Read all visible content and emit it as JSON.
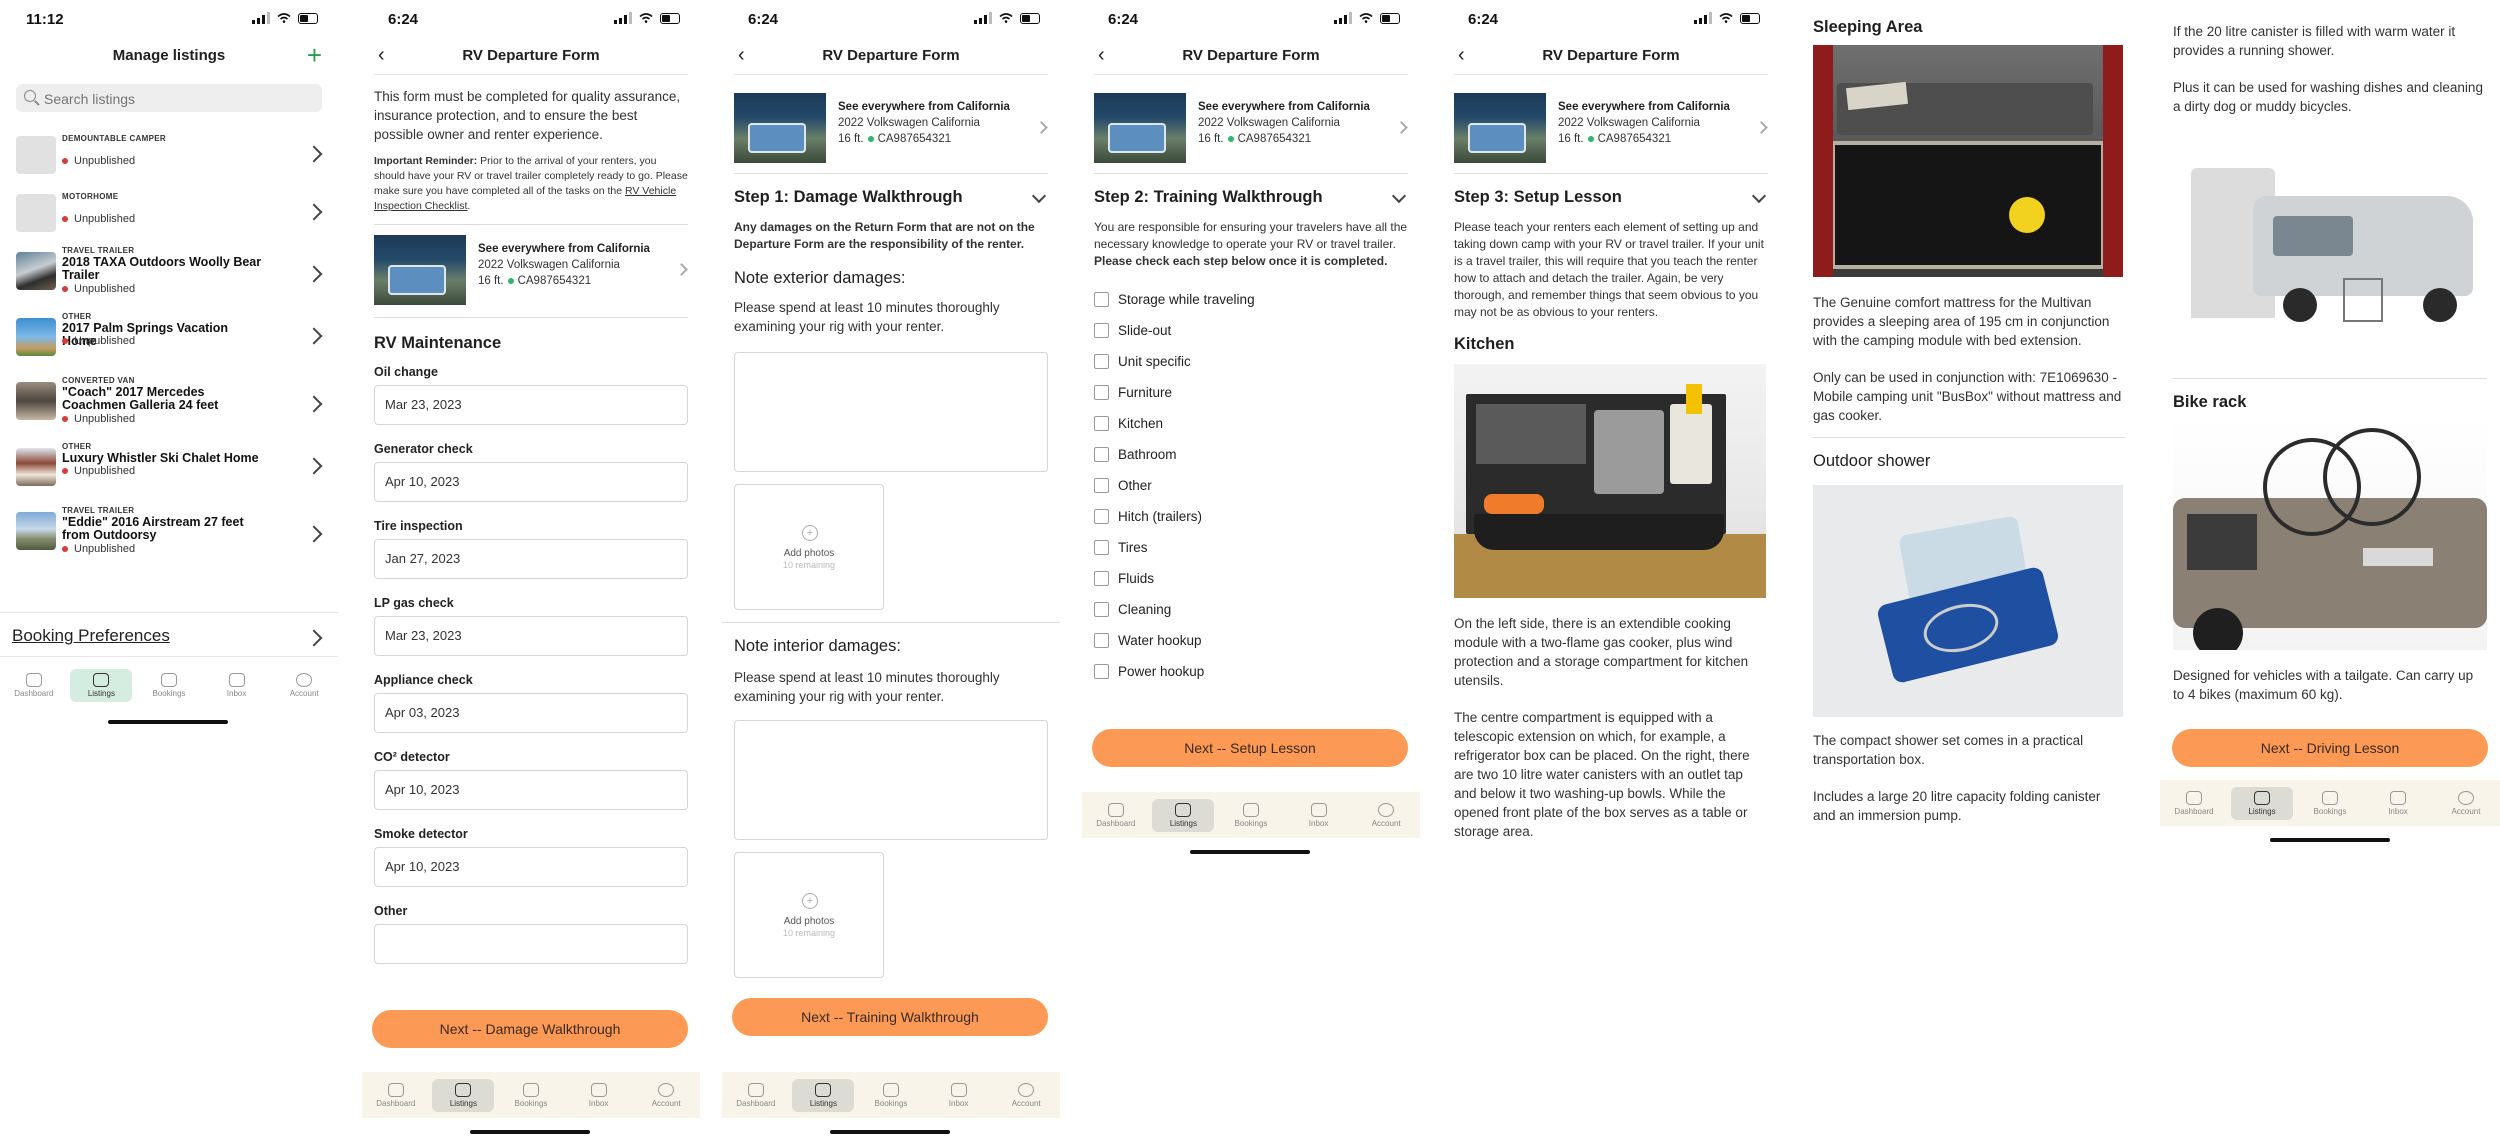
{
  "status_bars": [
    {
      "time": "11:12"
    },
    {
      "time": "6:24"
    },
    {
      "time": "6:24"
    },
    {
      "time": "6:24"
    },
    {
      "time": "6:24"
    }
  ],
  "tabs": [
    {
      "label": "Dashboard",
      "icon": "dashboard-icon"
    },
    {
      "label": "Listings",
      "icon": "listings-icon"
    },
    {
      "label": "Bookings",
      "icon": "bookings-icon"
    },
    {
      "label": "Inbox",
      "icon": "inbox-icon"
    },
    {
      "label": "Account",
      "icon": "account-icon"
    }
  ],
  "manage": {
    "title": "Manage listings",
    "search_placeholder": "Search listings",
    "items": [
      {
        "category": "DEMOUNTABLE CAMPER",
        "name": "",
        "status": "Unpublished"
      },
      {
        "category": "MOTORHOME",
        "name": "",
        "status": "Unpublished"
      },
      {
        "category": "TRAVEL TRAILER",
        "name": "2018 TAXA Outdoors Woolly Bear Trailer",
        "status": "Unpublished"
      },
      {
        "category": "OTHER",
        "name": "2017 Palm Springs Vacation Home",
        "status": "Unpublished"
      },
      {
        "category": "CONVERTED VAN",
        "name": "\"Coach\" 2017 Mercedes Coachmen Galleria 24 feet",
        "status": "Unpublished"
      },
      {
        "category": "OTHER",
        "name": "Luxury Whistler Ski Chalet Home",
        "status": "Unpublished"
      },
      {
        "category": "TRAVEL TRAILER",
        "name": "\"Eddie\" 2016 Airstream 27 feet from Outdoorsy",
        "status": "Unpublished"
      }
    ],
    "booking_prefs": "Booking Preferences"
  },
  "form": {
    "title": "RV Departure Form",
    "intro": "This form must be completed for quality assurance, insurance protection, and to ensure the best possible owner and renter experience.",
    "reminder_label": "Important Reminder:",
    "reminder_text": " Prior to the arrival of your renters, you should have your RV or travel trailer completely ready to go. Please make sure you have completed all of the tasks on the ",
    "reminder_link": "RV Vehicle Inspection Checklist",
    "reminder_end": "."
  },
  "vehicle": {
    "title": "See everywhere from California",
    "model": "2022 Volkswagen California",
    "length": "16 ft.",
    "plate": "CA987654321"
  },
  "maintenance": {
    "heading": "RV Maintenance",
    "fields": [
      {
        "label": "Oil change",
        "value": "Mar 23, 2023"
      },
      {
        "label": "Generator check",
        "value": "Apr 10, 2023"
      },
      {
        "label": "Tire inspection",
        "value": "Jan 27, 2023"
      },
      {
        "label": "LP gas check",
        "value": "Mar 23, 2023"
      },
      {
        "label": "Appliance check",
        "value": "Apr 03, 2023"
      },
      {
        "label": "CO² detector",
        "value": "Apr 10, 2023"
      },
      {
        "label": "Smoke detector",
        "value": "Apr 10, 2023"
      },
      {
        "label": "Other",
        "value": ""
      }
    ],
    "next": "Next -- Damage Walkthrough"
  },
  "damage": {
    "heading": "Step 1: Damage Walkthrough",
    "note": "Any damages on the Return Form that are not on the Departure Form are the responsibility of the renter.",
    "ext_heading": "Note exterior damages:",
    "ext_text": "Please spend at least 10 minutes thoroughly examining your rig with your renter.",
    "int_heading": "Note interior damages:",
    "int_text": "Please spend at least 10 minutes thoroughly examining your rig with your renter.",
    "add_photos": "Add photos",
    "remaining": "10 remaining",
    "next": "Next -- Training Walkthrough"
  },
  "training": {
    "heading": "Step 2: Training Walkthrough",
    "intro": "You are responsible for ensuring your travelers have all the necessary knowledge to operate your RV or travel trailer.",
    "intro_bold": "Please check each step below once it is completed.",
    "items": [
      "Storage while traveling",
      "Slide-out",
      "Unit specific",
      "Furniture",
      "Kitchen",
      "Bathroom",
      "Other",
      "Hitch (trailers)",
      "Tires",
      "Fluids",
      "Cleaning",
      "Water hookup",
      "Power hookup"
    ],
    "next": "Next -- Setup Lesson"
  },
  "setup": {
    "heading": "Step 3: Setup Lesson",
    "intro": "Please teach your renters each element of setting up and taking down camp with your RV or travel trailer. If your unit is a travel trailer, this will require that you teach the renter how to attach and detach the trailer. Again, be very thorough, and remember things that seem obvious to you may not be as obvious to your renters.",
    "kitchen_heading": "Kitchen",
    "kitchen_p1": "On the left side, there is an extendible cooking module with a two-flame gas cooker, plus wind protection and a storage compartment for kitchen utensils.",
    "kitchen_p2": "The centre compartment is equipped with a telescopic extension on which, for example, a refrigerator box can be placed. On the right, there are two 10 litre water canisters with an outlet tap and below it two washing-up bowls. While the opened front plate of the box serves as a table or storage area."
  },
  "sleeping": {
    "heading": "Sleeping Area",
    "p1": "The Genuine comfort mattress for the Multivan provides a sleeping area of 195 cm in conjunction with the camping module with bed extension.",
    "p2": "Only can be used in conjunction with: 7E1069630 - Mobile camping unit \"BusBox\" without mattress and gas cooker.",
    "shower_heading": "Outdoor shower",
    "shower_p1": "The compact shower set comes in a practical transportation box.",
    "shower_p2": "Includes a large 20 litre capacity folding canister and an immersion pump."
  },
  "bike": {
    "p1": "If the 20 litre canister is filled with warm water it provides a running shower.",
    "p2": "Plus it can be used for washing dishes and cleaning a dirty dog or muddy bicycles.",
    "heading": "Bike rack",
    "p3": "Designed for vehicles with a tailgate. Can carry up to 4 bikes (maximum 60 kg).",
    "next": "Next -- Driving Lesson"
  }
}
